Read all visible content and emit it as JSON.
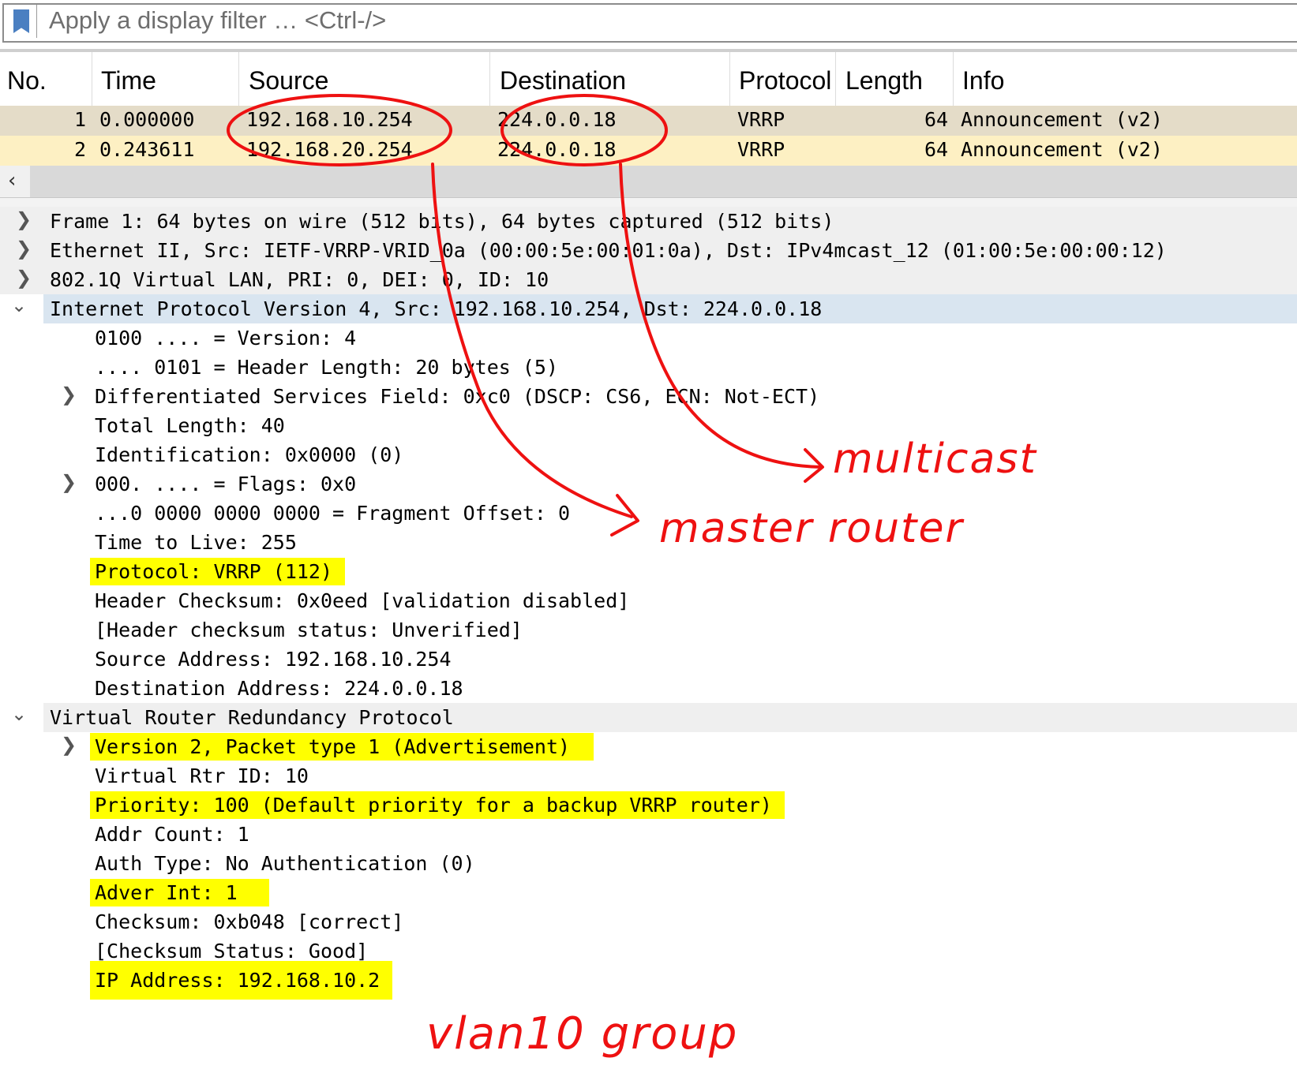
{
  "filter": {
    "placeholder": "Apply a display filter … <Ctrl-/>",
    "icon": "bookmark-icon"
  },
  "packet_list": {
    "columns": [
      "No.",
      "Time",
      "Source",
      "Destination",
      "Protocol",
      "Length",
      "Info"
    ],
    "rows": [
      {
        "no": "1",
        "time": "0.000000",
        "source": "192.168.10.254",
        "destination": "224.0.0.18",
        "protocol": "VRRP",
        "length": "64",
        "info": "Announcement (v2)"
      },
      {
        "no": "2",
        "time": "0.243611",
        "source": "192.168.20.254",
        "destination": "224.0.0.18",
        "protocol": "VRRP",
        "length": "64",
        "info": "Announcement (v2)"
      }
    ],
    "row_colors": [
      "#e4dcc8",
      "#fdf0c3"
    ]
  },
  "scroll": {
    "left_arrow": "‹"
  },
  "details": {
    "frame": "Frame 1: 64 bytes on wire (512 bits), 64 bytes captured (512 bits)",
    "ethernet": "Ethernet II, Src: IETF-VRRP-VRID_0a (00:00:5e:00:01:0a), Dst: IPv4mcast_12 (01:00:5e:00:00:12)",
    "vlan": "802.1Q Virtual LAN, PRI: 0, DEI: 0, ID: 10",
    "ipv4": "Internet Protocol Version 4, Src: 192.168.10.254, Dst: 224.0.0.18",
    "ip_fields": [
      "0100 .... = Version: 4",
      ".... 0101 = Header Length: 20 bytes (5)",
      "Differentiated Services Field: 0xc0 (DSCP: CS6, ECN: Not-ECT)",
      "Total Length: 40",
      "Identification: 0x0000 (0)",
      "000. .... = Flags: 0x0",
      "...0 0000 0000 0000 = Fragment Offset: 0",
      "Time to Live: 255",
      "Protocol: VRRP (112)",
      "Header Checksum: 0x0eed [validation disabled]",
      "[Header checksum status: Unverified]",
      "Source Address: 192.168.10.254",
      "Destination Address: 224.0.0.18"
    ],
    "vrrp": "Virtual Router Redundancy Protocol",
    "vrrp_fields": [
      "Version 2, Packet type 1 (Advertisement)",
      "Virtual Rtr ID: 10",
      "Priority: 100 (Default priority for a backup VRRP router)",
      "Addr Count: 1",
      "Auth Type: No Authentication (0)",
      "Adver Int: 1",
      "Checksum: 0xb048 [correct]",
      "[Checksum Status: Good]",
      "IP Address: 192.168.10.2"
    ]
  },
  "annotations": {
    "multicast": "multicast",
    "master_router": "master router",
    "vlan_group": "vlan10 group"
  },
  "colors": {
    "highlight": "#ffff00",
    "annotation": "#ee1111",
    "selected_row": "#d9e5f0"
  }
}
